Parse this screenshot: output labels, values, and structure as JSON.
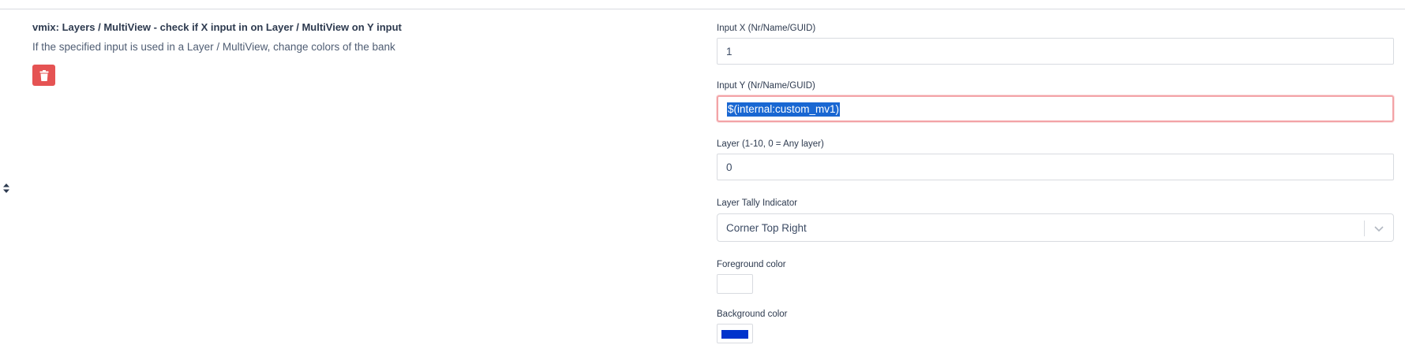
{
  "action": {
    "title": "vmix: Layers / MultiView - check if X input in on Layer / MultiView on Y input",
    "description": "If the specified input is used in a Layer / MultiView, change colors of the bank"
  },
  "icons": {
    "delete": "trash-icon",
    "drag": "sort-icon",
    "select_arrow": "chevron-down-icon"
  },
  "fields": {
    "input_x": {
      "label": "Input X (Nr/Name/GUID)",
      "value": "1"
    },
    "input_y": {
      "label": "Input Y (Nr/Name/GUID)",
      "value": "$(internal:custom_mv1)"
    },
    "layer": {
      "label": "Layer (1-10, 0 = Any layer)",
      "value": "0"
    },
    "tally": {
      "label": "Layer Tally Indicator",
      "value": "Corner Top Right"
    },
    "foreground": {
      "label": "Foreground color",
      "color": "#ffffff"
    },
    "background": {
      "label": "Background color",
      "color": "#0033cc"
    }
  },
  "colors": {
    "danger": "#e55353",
    "invalid_border": "#f3a3a7",
    "selection": "#1967d2"
  }
}
